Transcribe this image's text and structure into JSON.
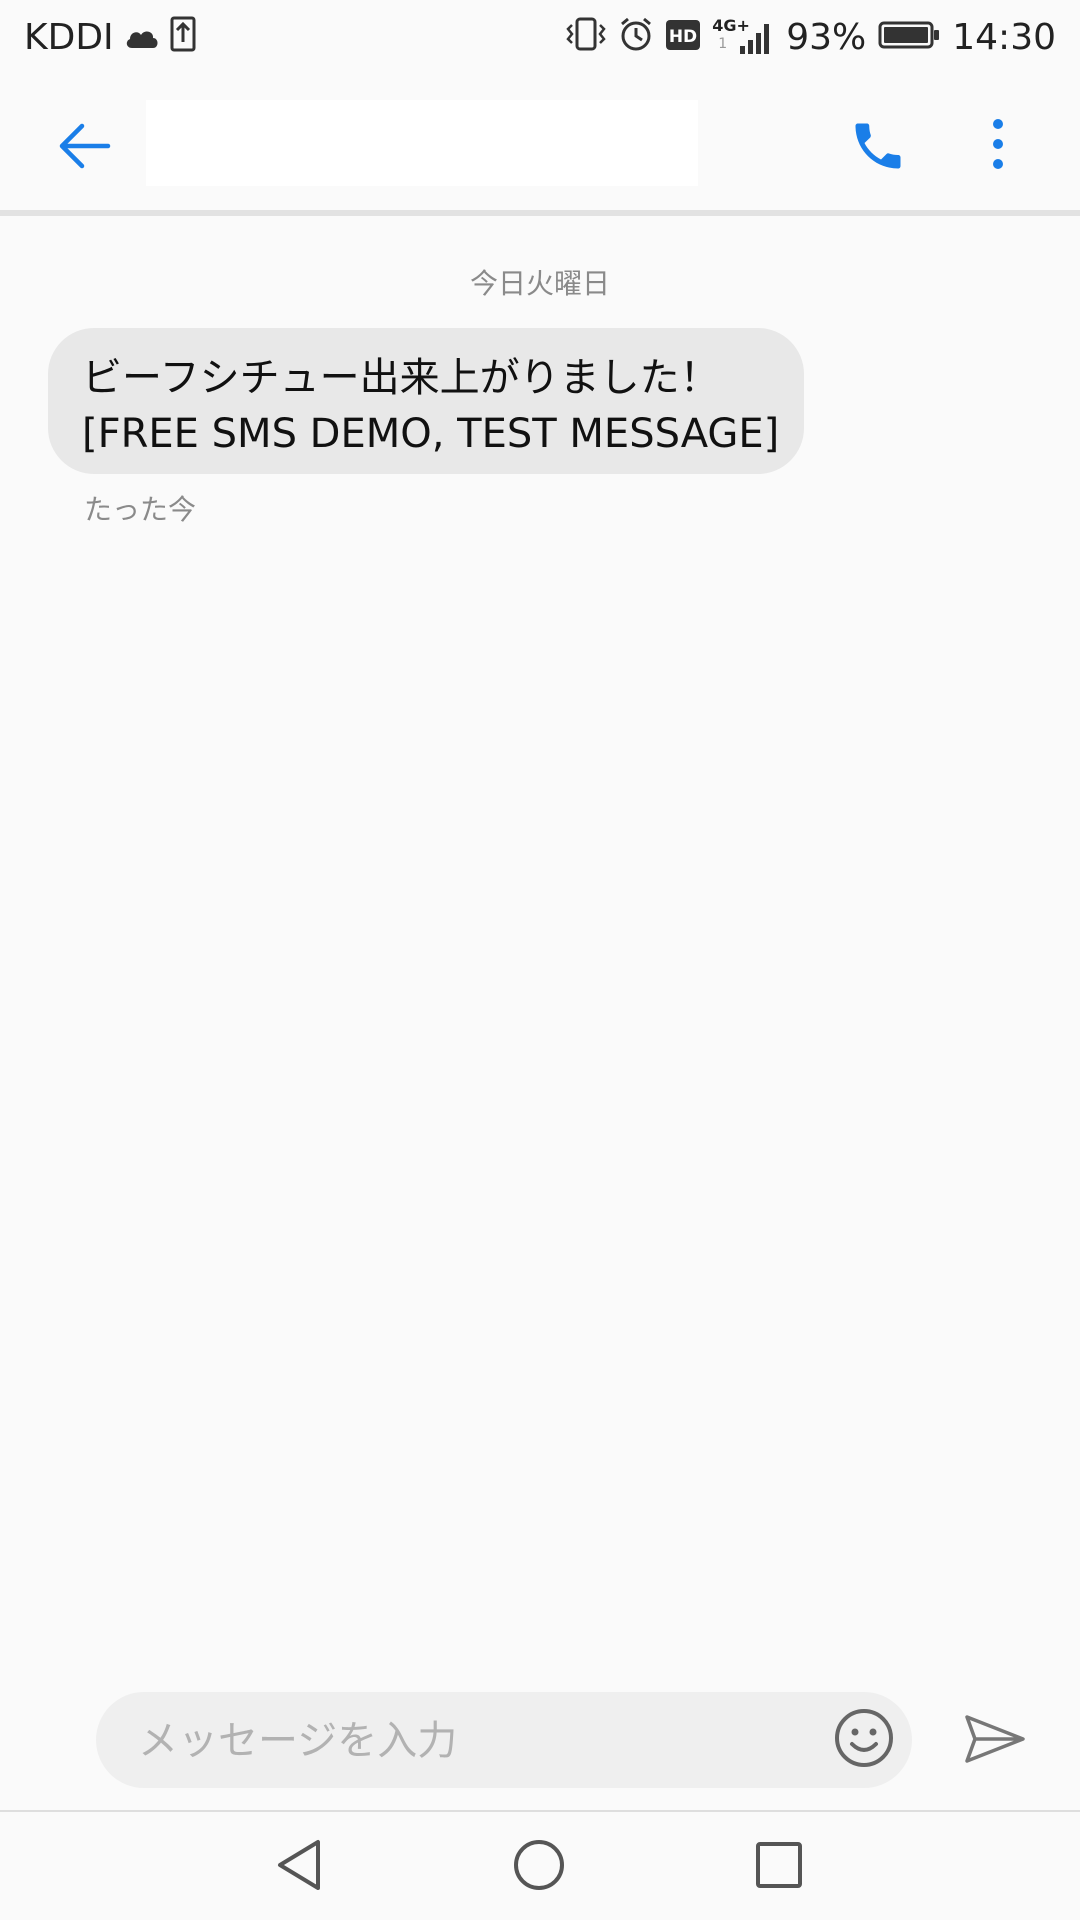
{
  "status_bar": {
    "carrier": "KDDI",
    "network_badge": "4G+",
    "network_badge_sub": "1",
    "battery": "93%",
    "time": "14:30",
    "left_icons": [
      "cloud-icon",
      "upload-icon"
    ],
    "right_icons": [
      "vibrate-icon",
      "alarm-icon",
      "hd-icon",
      "signal-icon",
      "battery-icon"
    ]
  },
  "app_bar": {
    "title": "",
    "back_icon": "arrow-left-icon",
    "call_icon": "phone-icon",
    "menu_icon": "more-vertical-icon",
    "accent_color": "#1a7ee8"
  },
  "conversation": {
    "date_header": "今日火曜日",
    "messages": [
      {
        "line1": "ビーフシチュー出来上がりました！",
        "line2": "[FREE SMS DEMO, TEST MESSAGE]",
        "time": "たった今"
      }
    ]
  },
  "composer": {
    "placeholder": "メッセージを入力",
    "value": "",
    "emoji_icon": "smiley-icon",
    "send_icon": "send-icon"
  },
  "nav_bar": {
    "icons": [
      "triangle-back-icon",
      "circle-home-icon",
      "square-recents-icon"
    ]
  }
}
